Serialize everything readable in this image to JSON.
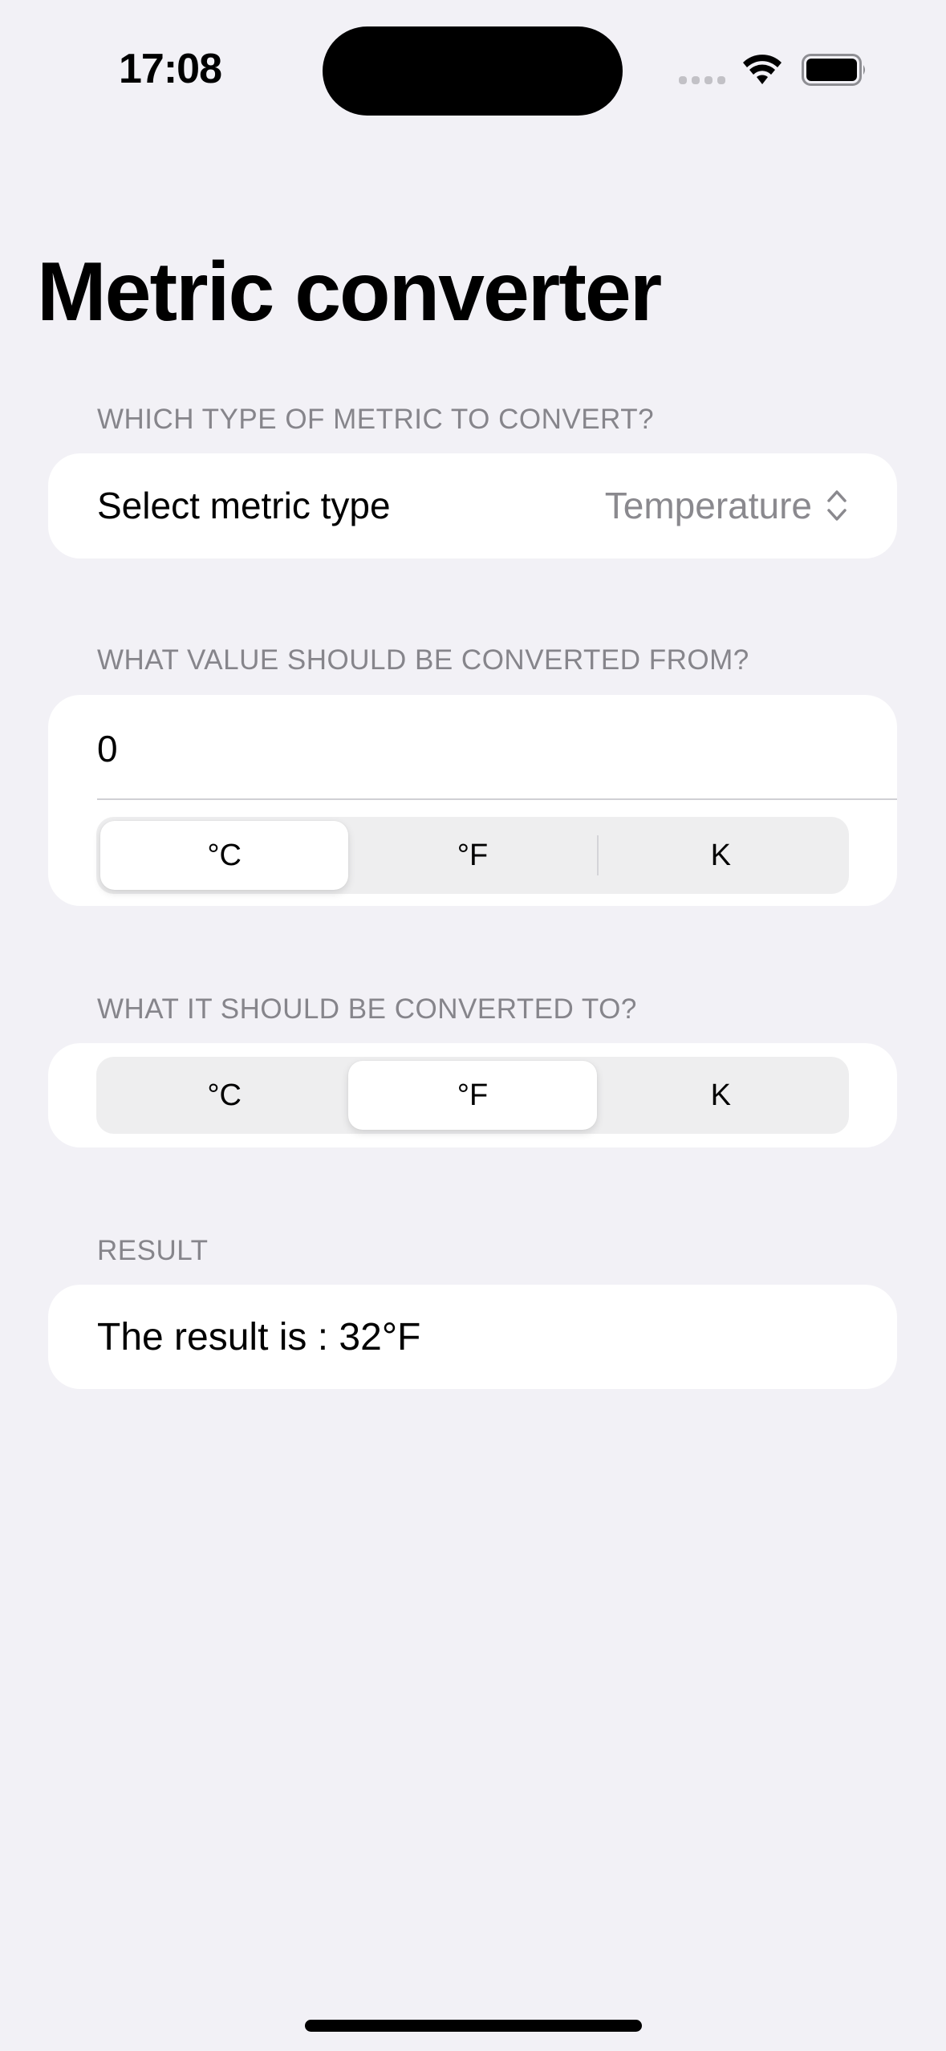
{
  "status_bar": {
    "time": "17:08",
    "icons": [
      "cellular-signal-icon",
      "wifi-icon",
      "battery-icon"
    ]
  },
  "page": {
    "title": "Metric converter"
  },
  "sections": {
    "metric_type": {
      "header": "WHICH TYPE OF METRIC TO CONVERT?",
      "label": "Select metric type",
      "selected_value": "Temperature",
      "icon": "chevron-up-down-icon"
    },
    "convert_from": {
      "header": "WHAT VALUE SHOULD BE CONVERTED FROM?",
      "input_value": "0",
      "units": [
        "°C",
        "°F",
        "K"
      ],
      "selected_unit": "°C"
    },
    "convert_to": {
      "header": "WHAT IT SHOULD BE CONVERTED TO?",
      "units": [
        "°C",
        "°F",
        "K"
      ],
      "selected_unit": "°F"
    },
    "result": {
      "header": "RESULT",
      "text": "The result is : 32°F"
    }
  },
  "colors": {
    "background": "#f2f1f6",
    "card": "#ffffff",
    "secondary_text": "#86858b",
    "segment_track": "#eeeeef"
  }
}
